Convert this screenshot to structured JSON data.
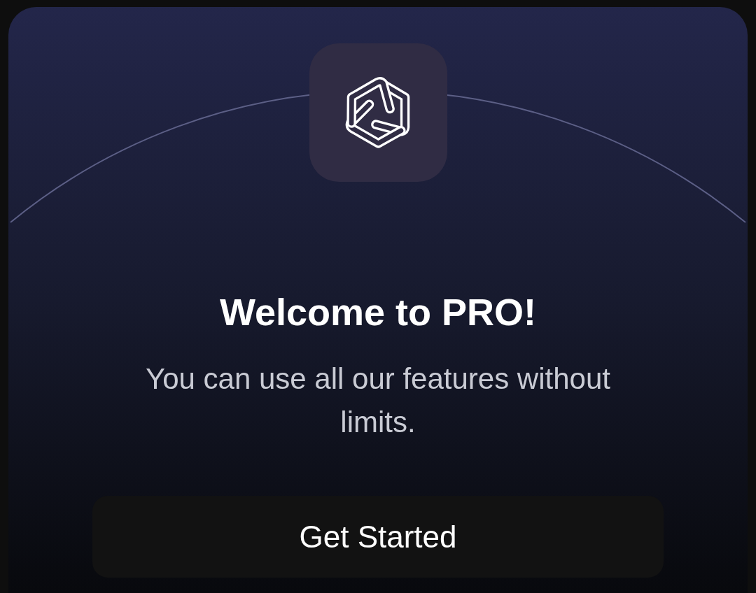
{
  "title": "Welcome to PRO!",
  "message": "You can use all our features without limits.",
  "button": {
    "label": "Get Started"
  }
}
